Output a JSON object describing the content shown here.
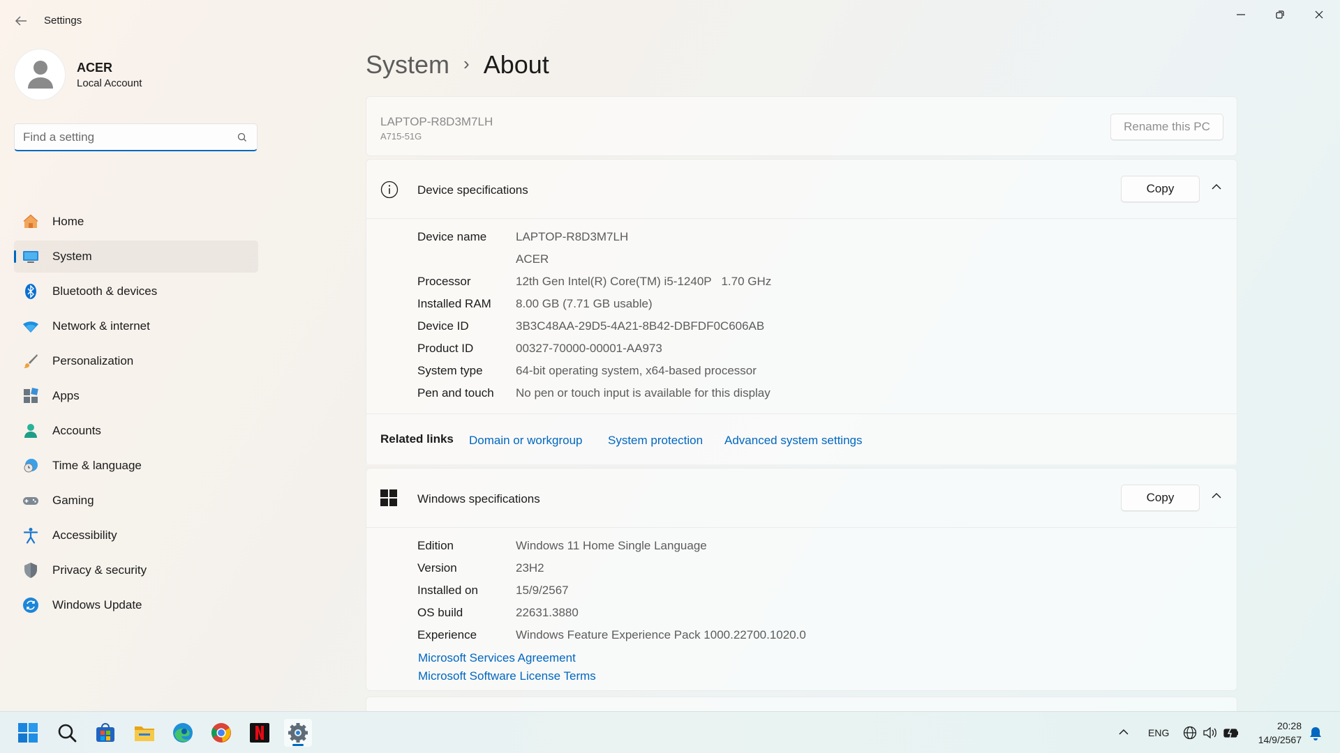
{
  "window": {
    "app_title": "Settings"
  },
  "profile": {
    "name": "ACER",
    "account_type": "Local Account"
  },
  "search": {
    "placeholder": "Find a setting"
  },
  "nav": {
    "items": [
      {
        "label": "Home",
        "icon": "home-icon"
      },
      {
        "label": "System",
        "icon": "system-icon",
        "active": true
      },
      {
        "label": "Bluetooth & devices",
        "icon": "bluetooth-icon"
      },
      {
        "label": "Network & internet",
        "icon": "wifi-icon"
      },
      {
        "label": "Personalization",
        "icon": "brush-icon"
      },
      {
        "label": "Apps",
        "icon": "apps-icon"
      },
      {
        "label": "Accounts",
        "icon": "account-icon"
      },
      {
        "label": "Time & language",
        "icon": "clock-globe-icon"
      },
      {
        "label": "Gaming",
        "icon": "gamepad-icon"
      },
      {
        "label": "Accessibility",
        "icon": "accessibility-icon"
      },
      {
        "label": "Privacy & security",
        "icon": "shield-icon"
      },
      {
        "label": "Windows Update",
        "icon": "update-icon"
      }
    ]
  },
  "breadcrumb": {
    "parent": "System",
    "separator": "›",
    "current": "About"
  },
  "pc": {
    "name": "LAPTOP-R8D3M7LH",
    "model": "A715-51G",
    "rename_label": "Rename this PC"
  },
  "device_specs": {
    "title": "Device specifications",
    "copy_label": "Copy",
    "rows": [
      {
        "label": "Device name",
        "value": "LAPTOP-R8D3M7LH"
      },
      {
        "label": "",
        "value": "ACER"
      },
      {
        "label": "Processor",
        "value": "12th Gen Intel(R) Core(TM) i5-1240P   1.70 GHz"
      },
      {
        "label": "Installed RAM",
        "value": "8.00 GB (7.71 GB usable)"
      },
      {
        "label": "Device ID",
        "value": "3B3C48AA-29D5-4A21-8B42-DBFDF0C606AB"
      },
      {
        "label": "Product ID",
        "value": "00327-70000-00001-AA973"
      },
      {
        "label": "System type",
        "value": "64-bit operating system, x64-based processor"
      },
      {
        "label": "Pen and touch",
        "value": "No pen or touch input is available for this display"
      }
    ]
  },
  "related_links": {
    "label": "Related links",
    "links": [
      "Domain or workgroup",
      "System protection",
      "Advanced system settings"
    ]
  },
  "windows_specs": {
    "title": "Windows specifications",
    "copy_label": "Copy",
    "rows": [
      {
        "label": "Edition",
        "value": "Windows 11 Home Single Language"
      },
      {
        "label": "Version",
        "value": "23H2"
      },
      {
        "label": "Installed on",
        "value": "15/9/2567"
      },
      {
        "label": "OS build",
        "value": "22631.3880"
      },
      {
        "label": "Experience",
        "value": "Windows Feature Experience Pack 1000.22700.1020.0"
      }
    ],
    "links": [
      "Microsoft Services Agreement",
      "Microsoft Software License Terms"
    ]
  },
  "taskbar": {
    "apps": [
      "start-icon",
      "search-icon",
      "store-icon",
      "file-explorer-icon",
      "edge-icon",
      "chrome-icon",
      "netflix-icon",
      "settings-icon"
    ],
    "tray": {
      "language": "ENG",
      "time": "20:28",
      "date": "14/9/2567"
    }
  },
  "colors": {
    "accent": "#0067c0",
    "text": "#1b1b1b",
    "secondary_text": "#5c5c5c"
  }
}
